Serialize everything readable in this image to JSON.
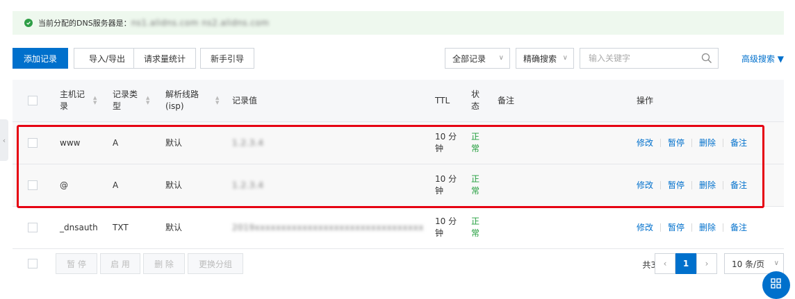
{
  "notice": {
    "label": "当前分配的DNS服务器是：",
    "value": "ns1.alidns.com ns2.alidns.com"
  },
  "toolbar": {
    "add_record": "添加记录",
    "import_export": "导入/导出",
    "request_stats": "请求量统计",
    "guide": "新手引导",
    "filter_all": "全部记录",
    "precise_search": "精确搜索",
    "search_placeholder": "输入关键字",
    "advanced_search": "高级搜索 ▼"
  },
  "table": {
    "headers": {
      "host": "主机记录",
      "type": "记录类型",
      "line": "解析线路(isp)",
      "value": "记录值",
      "ttl": "TTL",
      "status": "状态",
      "remark": "备注",
      "ops": "操作"
    },
    "rows": [
      {
        "host": "www",
        "type": "A",
        "line": "默认",
        "value": "1.2.3.4",
        "ttl": "10 分钟",
        "status": "正常",
        "remark": ""
      },
      {
        "host": "@",
        "type": "A",
        "line": "默认",
        "value": "1.2.3.4",
        "ttl": "10 分钟",
        "status": "正常",
        "remark": ""
      },
      {
        "host": "_dnsauth",
        "type": "TXT",
        "line": "默认",
        "value": "2019xxxxxxxxxxxxxxxxxxxxxxxxxxxxxxxx",
        "ttl": "10 分钟",
        "status": "正常",
        "remark": ""
      }
    ],
    "ops": {
      "modify": "修改",
      "pause": "暂停",
      "delete": "删除",
      "remark": "备注"
    }
  },
  "footer": {
    "pause": "暂 停",
    "enable": "启 用",
    "delete": "删 除",
    "change_group": "更换分组",
    "total": "共3条",
    "current_page": "1",
    "page_size": "10 条/页"
  },
  "colors": {
    "primary": "#0070cc",
    "success": "#1f9d3a",
    "highlight_frame": "#e60012",
    "notice_bg": "#eef8ee"
  }
}
